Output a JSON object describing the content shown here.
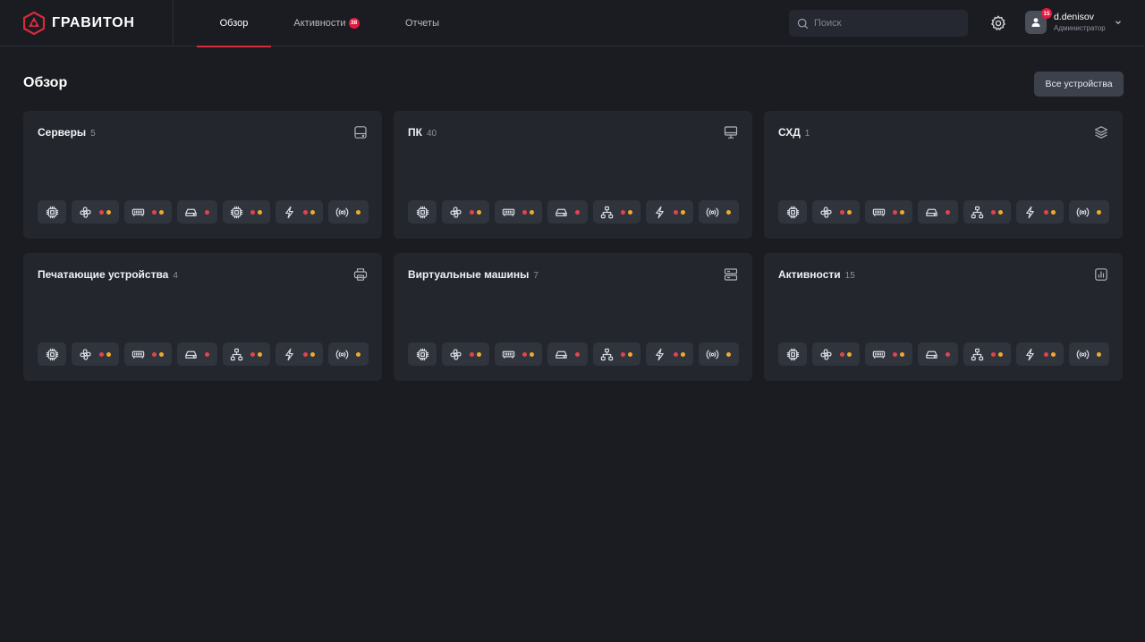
{
  "brand": {
    "name": "ГРАВИТОН",
    "accent": "#d92a3c"
  },
  "nav": {
    "tabs": [
      {
        "label": "Обзор",
        "active": true
      },
      {
        "label": "Активности",
        "badge": "38"
      },
      {
        "label": "Отчеты"
      }
    ]
  },
  "search": {
    "placeholder": "Поиск"
  },
  "user": {
    "name": "d.denisov",
    "role": "Администратор",
    "notifications": "15"
  },
  "page": {
    "title": "Обзор",
    "all_devices_label": "Все устройства"
  },
  "status_colors": {
    "critical": "#e2434f",
    "warning": "#f0a92e"
  },
  "cards": [
    {
      "title": "Серверы",
      "count": "5",
      "icon": "server-drive-icon",
      "chips": [
        {
          "icon": "processor-icon",
          "dots": []
        },
        {
          "icon": "fan-icon",
          "dots": [
            "red",
            "orange"
          ]
        },
        {
          "icon": "memory-icon",
          "dots": [
            "red",
            "orange"
          ]
        },
        {
          "icon": "hard-drive-icon",
          "dots": [
            "red"
          ]
        },
        {
          "icon": "processor-icon",
          "dots": [
            "red",
            "orange"
          ]
        },
        {
          "icon": "power-icon",
          "dots": [
            "red",
            "orange"
          ]
        },
        {
          "icon": "wireless-icon",
          "dots": [
            "orange"
          ]
        }
      ]
    },
    {
      "title": "ПК",
      "count": "40",
      "icon": "desktop-icon",
      "chips": [
        {
          "icon": "processor-icon",
          "dots": []
        },
        {
          "icon": "fan-icon",
          "dots": [
            "red",
            "orange"
          ]
        },
        {
          "icon": "memory-icon",
          "dots": [
            "red",
            "orange"
          ]
        },
        {
          "icon": "hard-drive-icon",
          "dots": [
            "red"
          ]
        },
        {
          "icon": "network-icon",
          "dots": [
            "red",
            "orange"
          ]
        },
        {
          "icon": "power-icon",
          "dots": [
            "red",
            "orange"
          ]
        },
        {
          "icon": "wireless-icon",
          "dots": [
            "orange"
          ]
        }
      ]
    },
    {
      "title": "СХД",
      "count": "1",
      "icon": "storage-layers-icon",
      "chips": [
        {
          "icon": "processor-icon",
          "dots": []
        },
        {
          "icon": "fan-icon",
          "dots": [
            "red",
            "orange"
          ]
        },
        {
          "icon": "memory-icon",
          "dots": [
            "red",
            "orange"
          ]
        },
        {
          "icon": "hard-drive-icon",
          "dots": [
            "red"
          ]
        },
        {
          "icon": "network-icon",
          "dots": [
            "red",
            "orange"
          ]
        },
        {
          "icon": "power-icon",
          "dots": [
            "red",
            "orange"
          ]
        },
        {
          "icon": "wireless-icon",
          "dots": [
            "orange"
          ]
        }
      ]
    },
    {
      "title": "Печатающие устройства",
      "count": "4",
      "icon": "printer-icon",
      "chips": [
        {
          "icon": "processor-icon",
          "dots": []
        },
        {
          "icon": "fan-icon",
          "dots": [
            "red",
            "orange"
          ]
        },
        {
          "icon": "memory-icon",
          "dots": [
            "red",
            "orange"
          ]
        },
        {
          "icon": "hard-drive-icon",
          "dots": [
            "red"
          ]
        },
        {
          "icon": "network-icon",
          "dots": [
            "red",
            "orange"
          ]
        },
        {
          "icon": "power-icon",
          "dots": [
            "red",
            "orange"
          ]
        },
        {
          "icon": "wireless-icon",
          "dots": [
            "orange"
          ]
        }
      ]
    },
    {
      "title": "Виртуальные машины",
      "count": "7",
      "icon": "server-rack-icon",
      "chips": [
        {
          "icon": "processor-icon",
          "dots": []
        },
        {
          "icon": "fan-icon",
          "dots": [
            "red",
            "orange"
          ]
        },
        {
          "icon": "memory-icon",
          "dots": [
            "red",
            "orange"
          ]
        },
        {
          "icon": "hard-drive-icon",
          "dots": [
            "red"
          ]
        },
        {
          "icon": "network-icon",
          "dots": [
            "red",
            "orange"
          ]
        },
        {
          "icon": "power-icon",
          "dots": [
            "red",
            "orange"
          ]
        },
        {
          "icon": "wireless-icon",
          "dots": [
            "orange"
          ]
        }
      ]
    },
    {
      "title": "Активности",
      "count": "15",
      "icon": "activity-chart-icon",
      "chips": [
        {
          "icon": "processor-icon",
          "dots": []
        },
        {
          "icon": "fan-icon",
          "dots": [
            "red",
            "orange"
          ]
        },
        {
          "icon": "memory-icon",
          "dots": [
            "red",
            "orange"
          ]
        },
        {
          "icon": "hard-drive-icon",
          "dots": [
            "red"
          ]
        },
        {
          "icon": "network-icon",
          "dots": [
            "red",
            "orange"
          ]
        },
        {
          "icon": "power-icon",
          "dots": [
            "red",
            "orange"
          ]
        },
        {
          "icon": "wireless-icon",
          "dots": [
            "orange"
          ]
        }
      ]
    }
  ]
}
